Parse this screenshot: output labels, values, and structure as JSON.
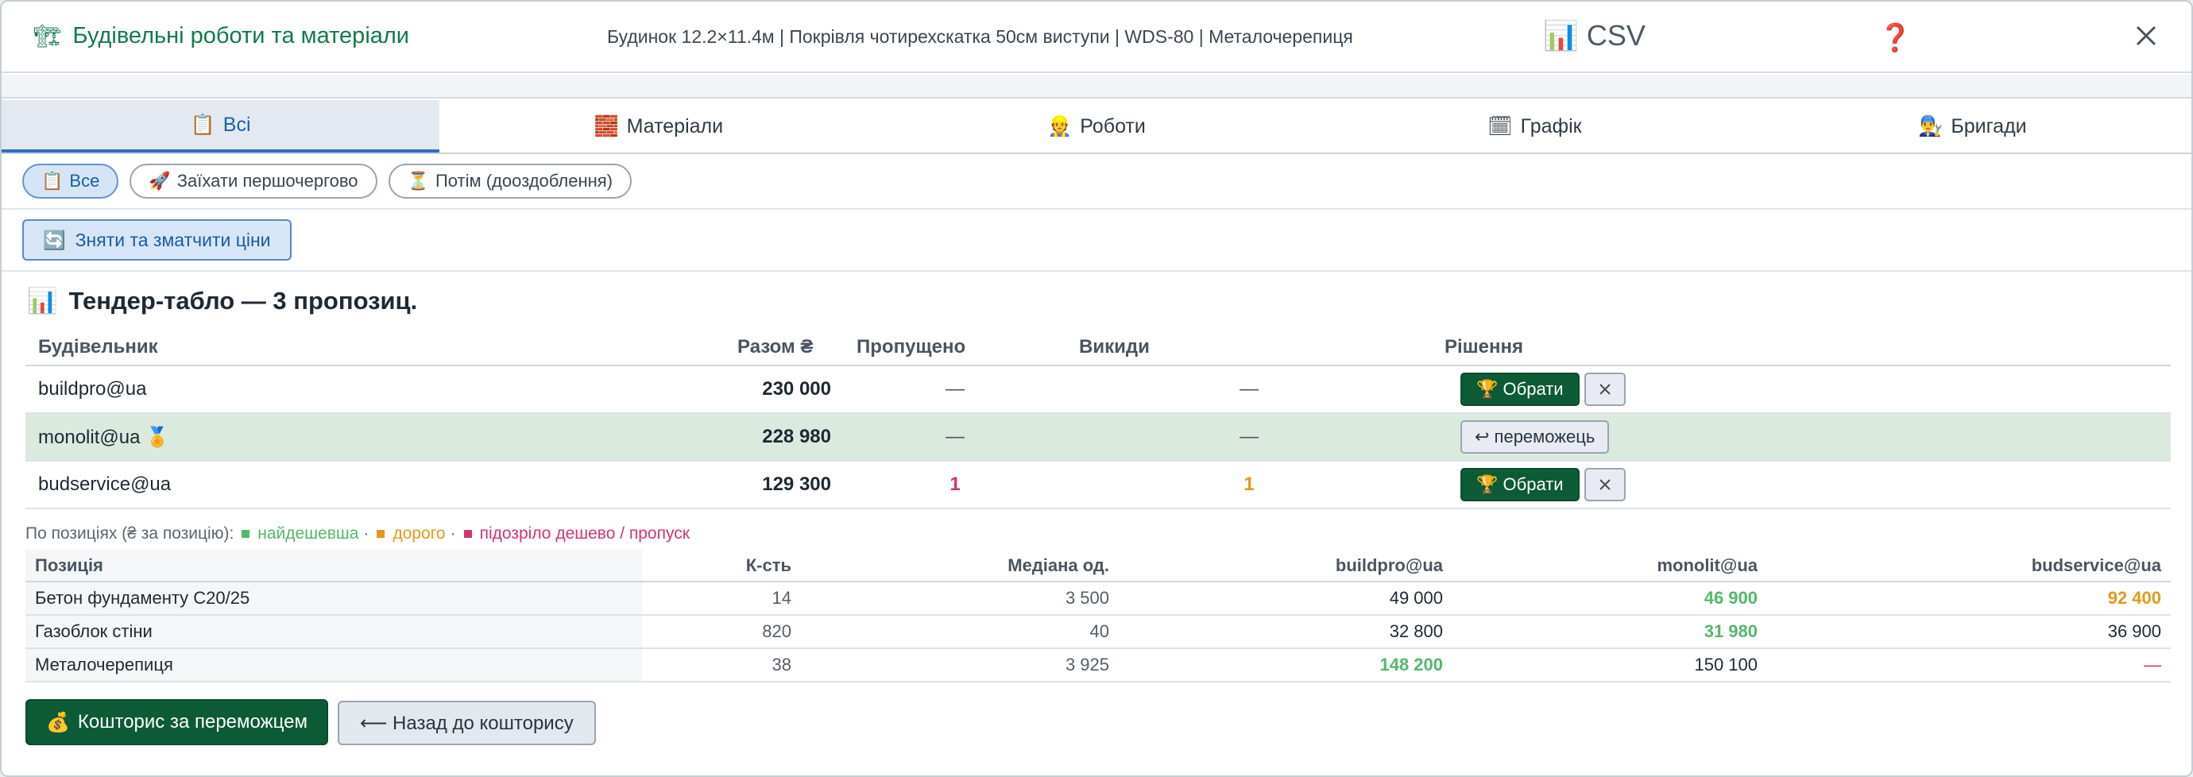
{
  "header": {
    "icon": "🏗",
    "title": "Будівельні роботи та матеріали",
    "summary": "Будинок 12.2×11.4м | Покрівля чотирехскатка 50см виступи | WDS-80 | Металочерепиця",
    "csv_icon": "📊",
    "csv_label": "CSV",
    "help_label": "❓",
    "accent": "#117a4c"
  },
  "tabs": [
    {
      "icon": "📋",
      "label": "Всі",
      "active": true
    },
    {
      "icon": "🧱",
      "label": "Матеріали"
    },
    {
      "icon": "👷",
      "label": "Роботи"
    },
    {
      "icon": "🗓",
      "label": "Графік"
    },
    {
      "icon": "👨‍🔧",
      "label": "Бригади"
    }
  ],
  "filters": [
    {
      "icon": "📋",
      "label": "Все",
      "active": true
    },
    {
      "icon": "🚀",
      "label": "Заїхати першочергово"
    },
    {
      "icon": "⏳",
      "label": "Потім (дооздоблення)"
    }
  ],
  "action": {
    "icon": "🔄",
    "label": "Зняти та зматчити ціни"
  },
  "tender": {
    "icon": "📊",
    "title": "Тендер-табло — 3 пропозиц.",
    "headers": {
      "builder": "Будівельник",
      "total": "Разом ₴",
      "skipped": "Пропущено",
      "outliers": "Викиди",
      "decision": "Рішення"
    },
    "rows": [
      {
        "builder": "buildpro@ua",
        "badge": "",
        "total": "230 000",
        "skipped": "—",
        "outliers": "—",
        "choose_label": "🏆 Обрати"
      },
      {
        "builder": "monolit@ua",
        "badge": "🏅",
        "total": "228 980",
        "skipped": "—",
        "outliers": "—",
        "undo_label": "↩ переможець"
      },
      {
        "builder": "budservice@ua",
        "badge": "",
        "total": "129 300",
        "skipped": "1",
        "outliers": "1",
        "choose_label": "🏆 Обрати"
      }
    ]
  },
  "legend": {
    "prefix": "По позиціях (₴ за позицію):",
    "cheapest": "найдешевша",
    "expensive": "дорого",
    "suspicious": "підозріло дешево / пропуск",
    "sep": "·",
    "colors": {
      "cheapest": "#52b86a",
      "expensive": "#e09a1a",
      "suspicious": "#d6336c"
    }
  },
  "positions": {
    "headers": {
      "position": "Позиція",
      "qty": "К-сть",
      "median": "Медіана од.",
      "b1": "buildpro@ua",
      "b2": "monolit@ua",
      "b3": "budservice@ua"
    },
    "rows": [
      {
        "position": "Бетон фундаменту C20/25",
        "qty": "14",
        "median": "3 500",
        "b1": "49 000",
        "b2": "46 900",
        "b3": "92 400"
      },
      {
        "position": "Газоблок стіни",
        "qty": "820",
        "median": "40",
        "b1": "32 800",
        "b2": "31 980",
        "b3": "36 900"
      },
      {
        "position": "Металочерепиця",
        "qty": "38",
        "median": "3 925",
        "b1": "148 200",
        "b2": "150 100",
        "b3": "—"
      }
    ]
  },
  "bottom": {
    "primary_icon": "💰",
    "primary": "Кошторис за переможцем",
    "secondary": "⟵ Назад до кошторису"
  }
}
